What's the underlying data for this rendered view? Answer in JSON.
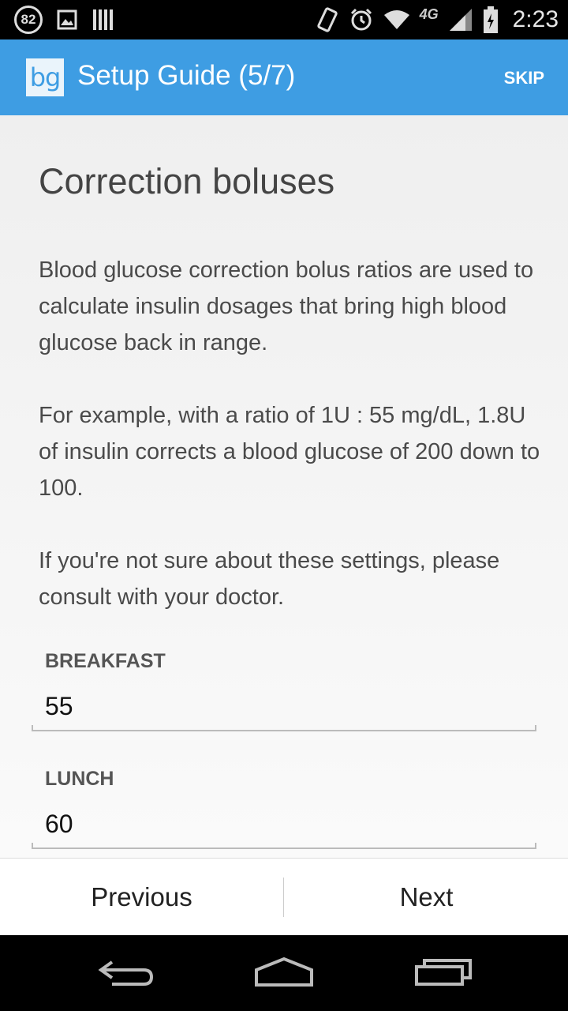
{
  "status_bar": {
    "notification_count": "82",
    "network": "4G",
    "time": "2:23"
  },
  "app_bar": {
    "logo": "bg",
    "title": "Setup Guide (5/7)",
    "skip_label": "SKIP"
  },
  "content": {
    "heading": "Correction boluses",
    "paragraphs": [
      "Blood glucose correction bolus ratios are used to calculate insulin dosages that bring high blood glucose back in range.",
      "For example, with a ratio of 1U : 55 mg/dL, 1.8U of insulin corrects a blood glucose of 200 down to 100.",
      "If you're not sure about these settings, please consult with your doctor."
    ],
    "fields": [
      {
        "label": "BREAKFAST",
        "value": "55"
      },
      {
        "label": "LUNCH",
        "value": "60"
      }
    ]
  },
  "bottom_bar": {
    "previous_label": "Previous",
    "next_label": "Next"
  },
  "colors": {
    "accent": "#3e9de3"
  }
}
